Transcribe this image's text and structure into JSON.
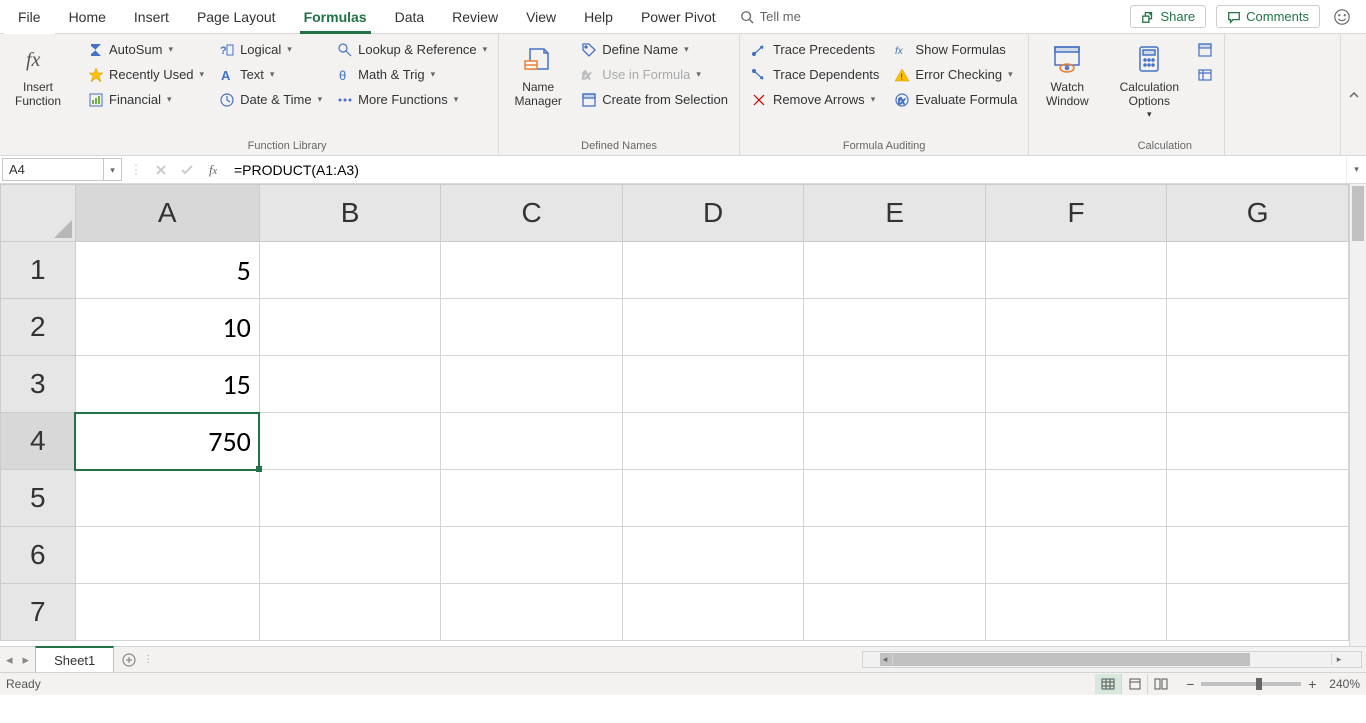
{
  "tabs": {
    "file": "File",
    "home": "Home",
    "insert": "Insert",
    "pagelayout": "Page Layout",
    "formulas": "Formulas",
    "data": "Data",
    "review": "Review",
    "view": "View",
    "help": "Help",
    "powerpivot": "Power Pivot",
    "tellme": "Tell me"
  },
  "actions": {
    "share": "Share",
    "comments": "Comments"
  },
  "ribbon": {
    "insertfn": "Insert Function",
    "fl": {
      "autosum": "AutoSum",
      "recent": "Recently Used",
      "financial": "Financial",
      "logical": "Logical",
      "text": "Text",
      "datetime": "Date & Time",
      "lookup": "Lookup & Reference",
      "mathtrig": "Math & Trig",
      "more": "More Functions",
      "group": "Function Library"
    },
    "dn": {
      "name": "Name Manager",
      "define": "Define Name",
      "usein": "Use in Formula",
      "createfrom": "Create from Selection",
      "group": "Defined Names"
    },
    "fa": {
      "traceprec": "Trace Precedents",
      "tracedep": "Trace Dependents",
      "removearr": "Remove Arrows",
      "showf": "Show Formulas",
      "errchk": "Error Checking",
      "eval": "Evaluate Formula",
      "group": "Formula Auditing"
    },
    "watch": "Watch Window",
    "calcopt": "Calculation Options",
    "calcgroup": "Calculation"
  },
  "fbar": {
    "cellref": "A4",
    "formula": "=PRODUCT(A1:A3)"
  },
  "grid": {
    "cols": [
      "A",
      "B",
      "C",
      "D",
      "E",
      "F",
      "G"
    ],
    "rows": [
      "1",
      "2",
      "3",
      "4",
      "5",
      "6",
      "7"
    ],
    "a1": "5",
    "a2": "10",
    "a3": "15",
    "a4": "750"
  },
  "sheet": {
    "name": "Sheet1"
  },
  "status": {
    "ready": "Ready",
    "zoom": "240%"
  }
}
